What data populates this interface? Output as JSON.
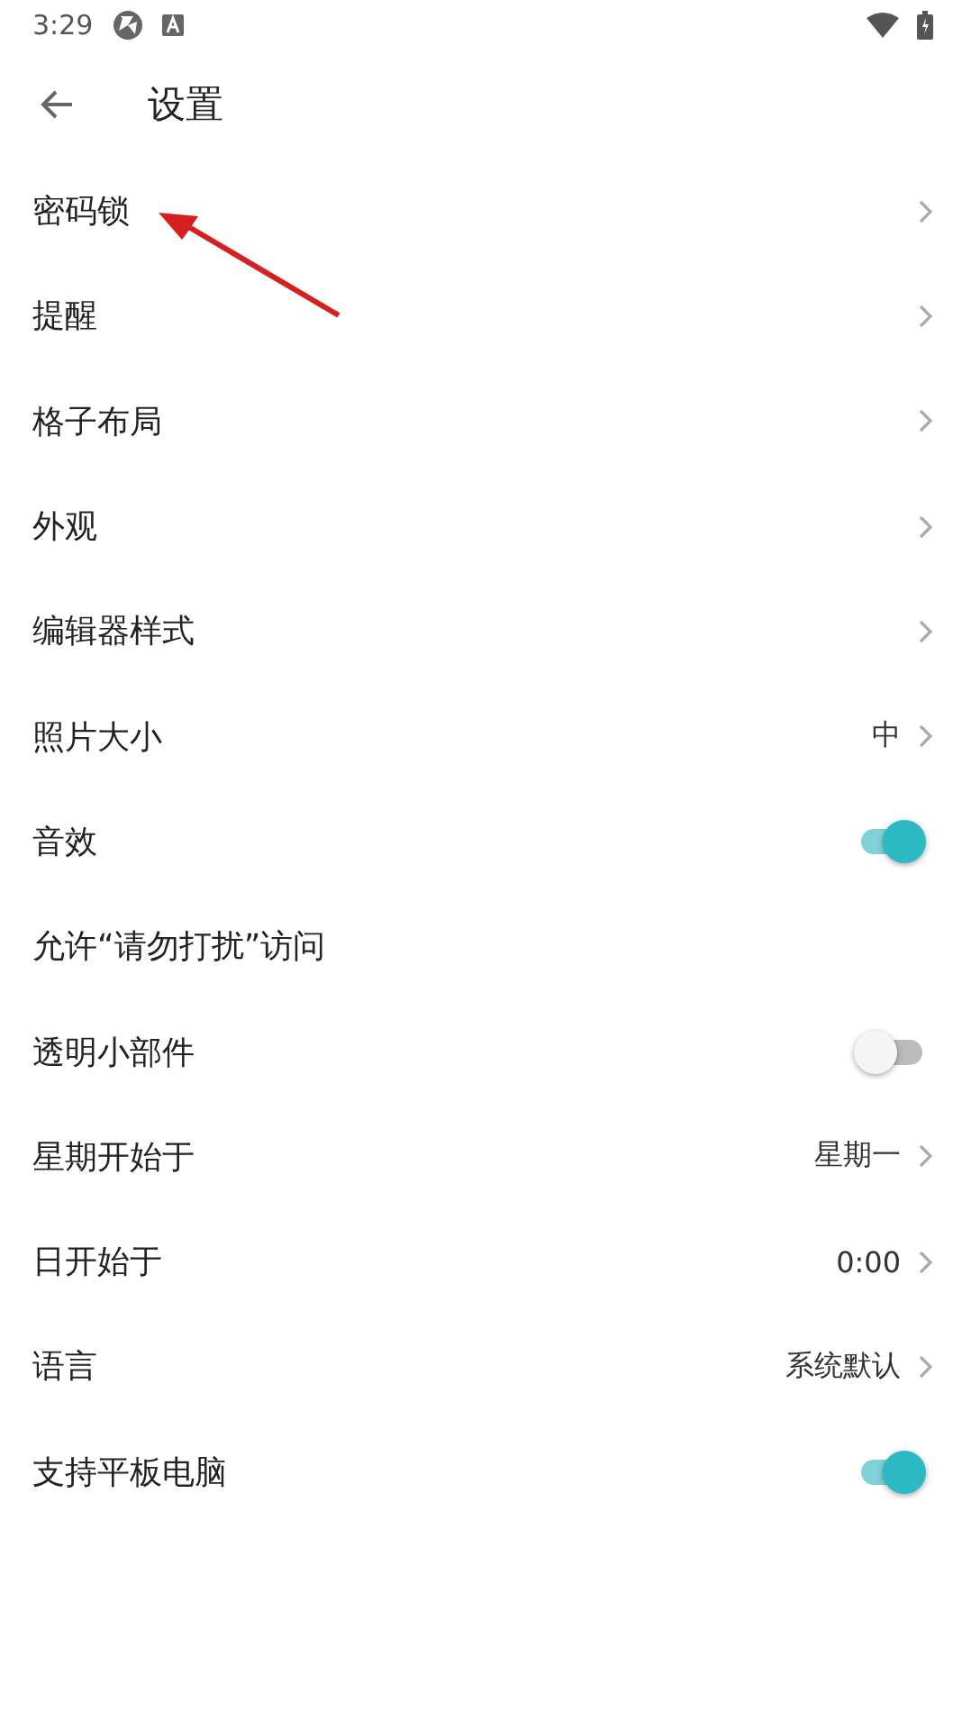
{
  "status_bar": {
    "time": "3:29"
  },
  "toolbar": {
    "title": "设置"
  },
  "settings": [
    {
      "kind": "link",
      "label": "密码锁"
    },
    {
      "kind": "link",
      "label": "提醒"
    },
    {
      "kind": "link",
      "label": "格子布局"
    },
    {
      "kind": "link",
      "label": "外观"
    },
    {
      "kind": "link",
      "label": "编辑器样式"
    },
    {
      "kind": "link",
      "label": "照片大小",
      "value": "中"
    },
    {
      "kind": "toggle",
      "label": "音效",
      "on": true
    },
    {
      "kind": "plain",
      "label": "允许“请勿打扰”访问"
    },
    {
      "kind": "toggle",
      "label": "透明小部件",
      "on": false
    },
    {
      "kind": "link",
      "label": "星期开始于",
      "value": "星期一"
    },
    {
      "kind": "link",
      "label": "日开始于",
      "value": "0:00"
    },
    {
      "kind": "link",
      "label": "语言",
      "value": "系统默认"
    },
    {
      "kind": "toggle",
      "label": "支持平板电脑",
      "on": true
    }
  ]
}
